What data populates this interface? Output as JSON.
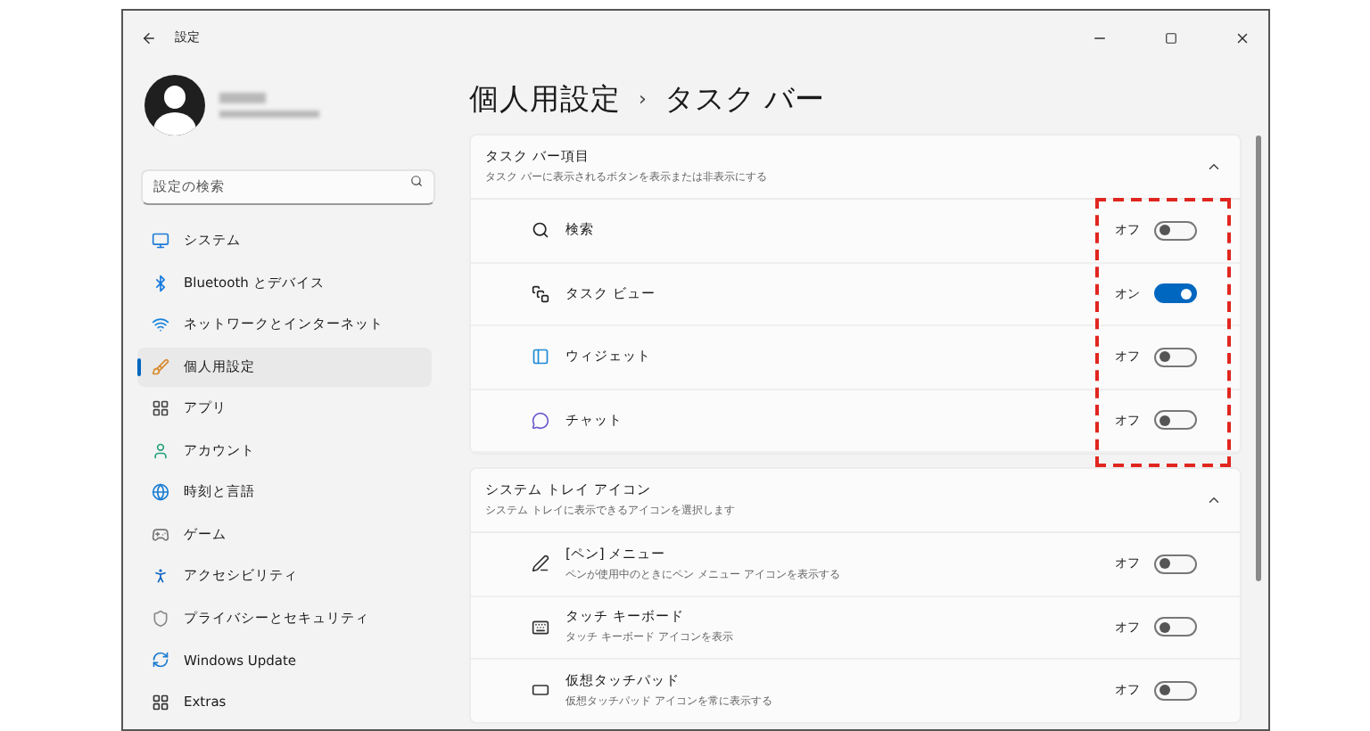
{
  "window": {
    "title": "設定"
  },
  "sidebar": {
    "search": {
      "placeholder": "設定の検索"
    },
    "items": [
      {
        "label": "システム",
        "selected": false
      },
      {
        "label": "Bluetooth とデバイス",
        "selected": false
      },
      {
        "label": "ネットワークとインターネット",
        "selected": false
      },
      {
        "label": "個人用設定",
        "selected": true
      },
      {
        "label": "アプリ",
        "selected": false
      },
      {
        "label": "アカウント",
        "selected": false
      },
      {
        "label": "時刻と言語",
        "selected": false
      },
      {
        "label": "ゲーム",
        "selected": false
      },
      {
        "label": "アクセシビリティ",
        "selected": false
      },
      {
        "label": "プライバシーとセキュリティ",
        "selected": false
      },
      {
        "label": "Windows Update",
        "selected": false
      },
      {
        "label": "Extras",
        "selected": false
      }
    ]
  },
  "header": {
    "parent": "個人用設定",
    "separator": "›",
    "title": "タスク バー"
  },
  "sections": [
    {
      "title": "タスク バー項目",
      "description": "タスク バーに表示されるボタンを表示または非表示にする",
      "expanded": true,
      "highlighted": true,
      "items": [
        {
          "label": "検索",
          "state_label": "オフ",
          "on": false
        },
        {
          "label": "タスク ビュー",
          "state_label": "オン",
          "on": true
        },
        {
          "label": "ウィジェット",
          "state_label": "オフ",
          "on": false
        },
        {
          "label": "チャット",
          "state_label": "オフ",
          "on": false
        }
      ]
    },
    {
      "title": "システム トレイ アイコン",
      "description": "システム トレイに表示できるアイコンを選択します",
      "expanded": true,
      "highlighted": false,
      "items": [
        {
          "label": "[ペン] メニュー",
          "description": "ペンが使用中のときにペン メニュー アイコンを表示する",
          "state_label": "オフ",
          "on": false
        },
        {
          "label": "タッチ キーボード",
          "description": "タッチ キーボード アイコンを表示",
          "state_label": "オフ",
          "on": false
        },
        {
          "label": "仮想タッチパッド",
          "description": "仮想タッチパッド アイコンを常に表示する",
          "state_label": "オフ",
          "on": false
        }
      ]
    }
  ]
}
